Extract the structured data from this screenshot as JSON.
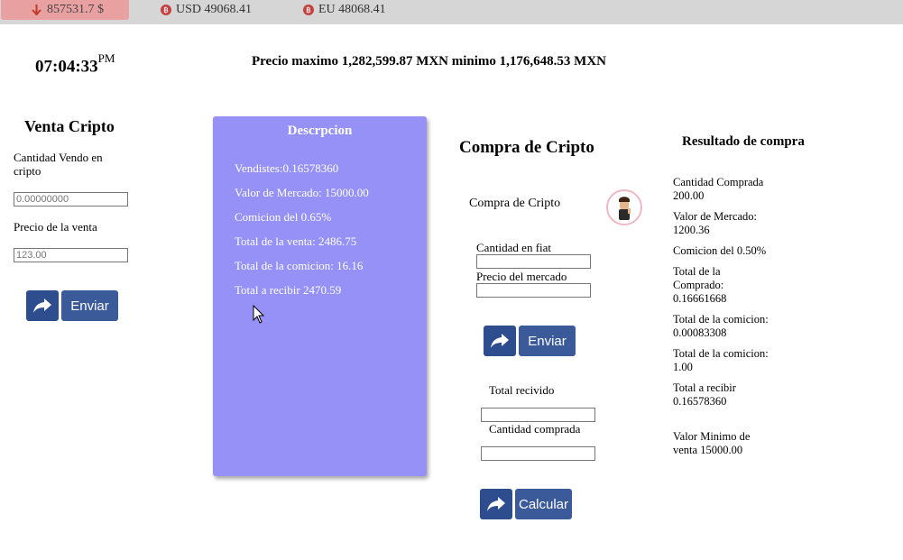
{
  "topbar": {
    "ticker_main": "857531.7 $",
    "ticker_usd": "USD 49068.41",
    "ticker_eu": "EU 48068.41",
    "arrow_icon": "arrow-down-icon",
    "coin_icon": "bitcoin-icon",
    "coin_glyph": "฿"
  },
  "header": {
    "clock": "07:04:33",
    "clock_suffix": "PM",
    "price_line": "Precio maximo 1,282,599.87 MXN minimo 1,176,648.53 MXN"
  },
  "venta": {
    "title": "Venta Cripto",
    "cantidad_label": "Cantidad Vendo en cripto",
    "cantidad_placeholder": "0.00000000",
    "precio_label": "Precio de la venta",
    "precio_placeholder": "123.00",
    "submit_label": "Enviar"
  },
  "descripcion": {
    "title": "Descrpcion",
    "lines": [
      "Vendistes:0.16578360",
      "Valor de Mercado: 15000.00",
      "Comicion del 0.65%",
      "Total de la venta: 2486.75",
      "Total de la comicion: 16.16",
      "Total a recibir 2470.59"
    ]
  },
  "compra": {
    "title": "Compra de Cripto",
    "subtitle": "Compra de Cripto",
    "fiat_label": "Cantidad en fiat",
    "mercado_label": "Precio del mercado",
    "submit_label": "Enviar",
    "total_label": "Total recivido",
    "comprada_label": "Cantidad comprada",
    "calc_label": "Calcular"
  },
  "resultado": {
    "title": "Resultado de compra",
    "items": [
      "Cantidad Comprada 200.00",
      "Valor de Mercado: 1200.36",
      "Comicion del 0.50%",
      "Total de la Comprado: 0.16661668",
      "Total de la comicion: 0.00083308",
      "Total de la comicion: 1.00",
      "Total a recibir 0.16578360",
      "Valor Minimo de venta 15000.00"
    ]
  },
  "colors": {
    "panel": "#9591f7",
    "button": "#3a5a9a",
    "ticker_down": "#e8a0a0"
  }
}
